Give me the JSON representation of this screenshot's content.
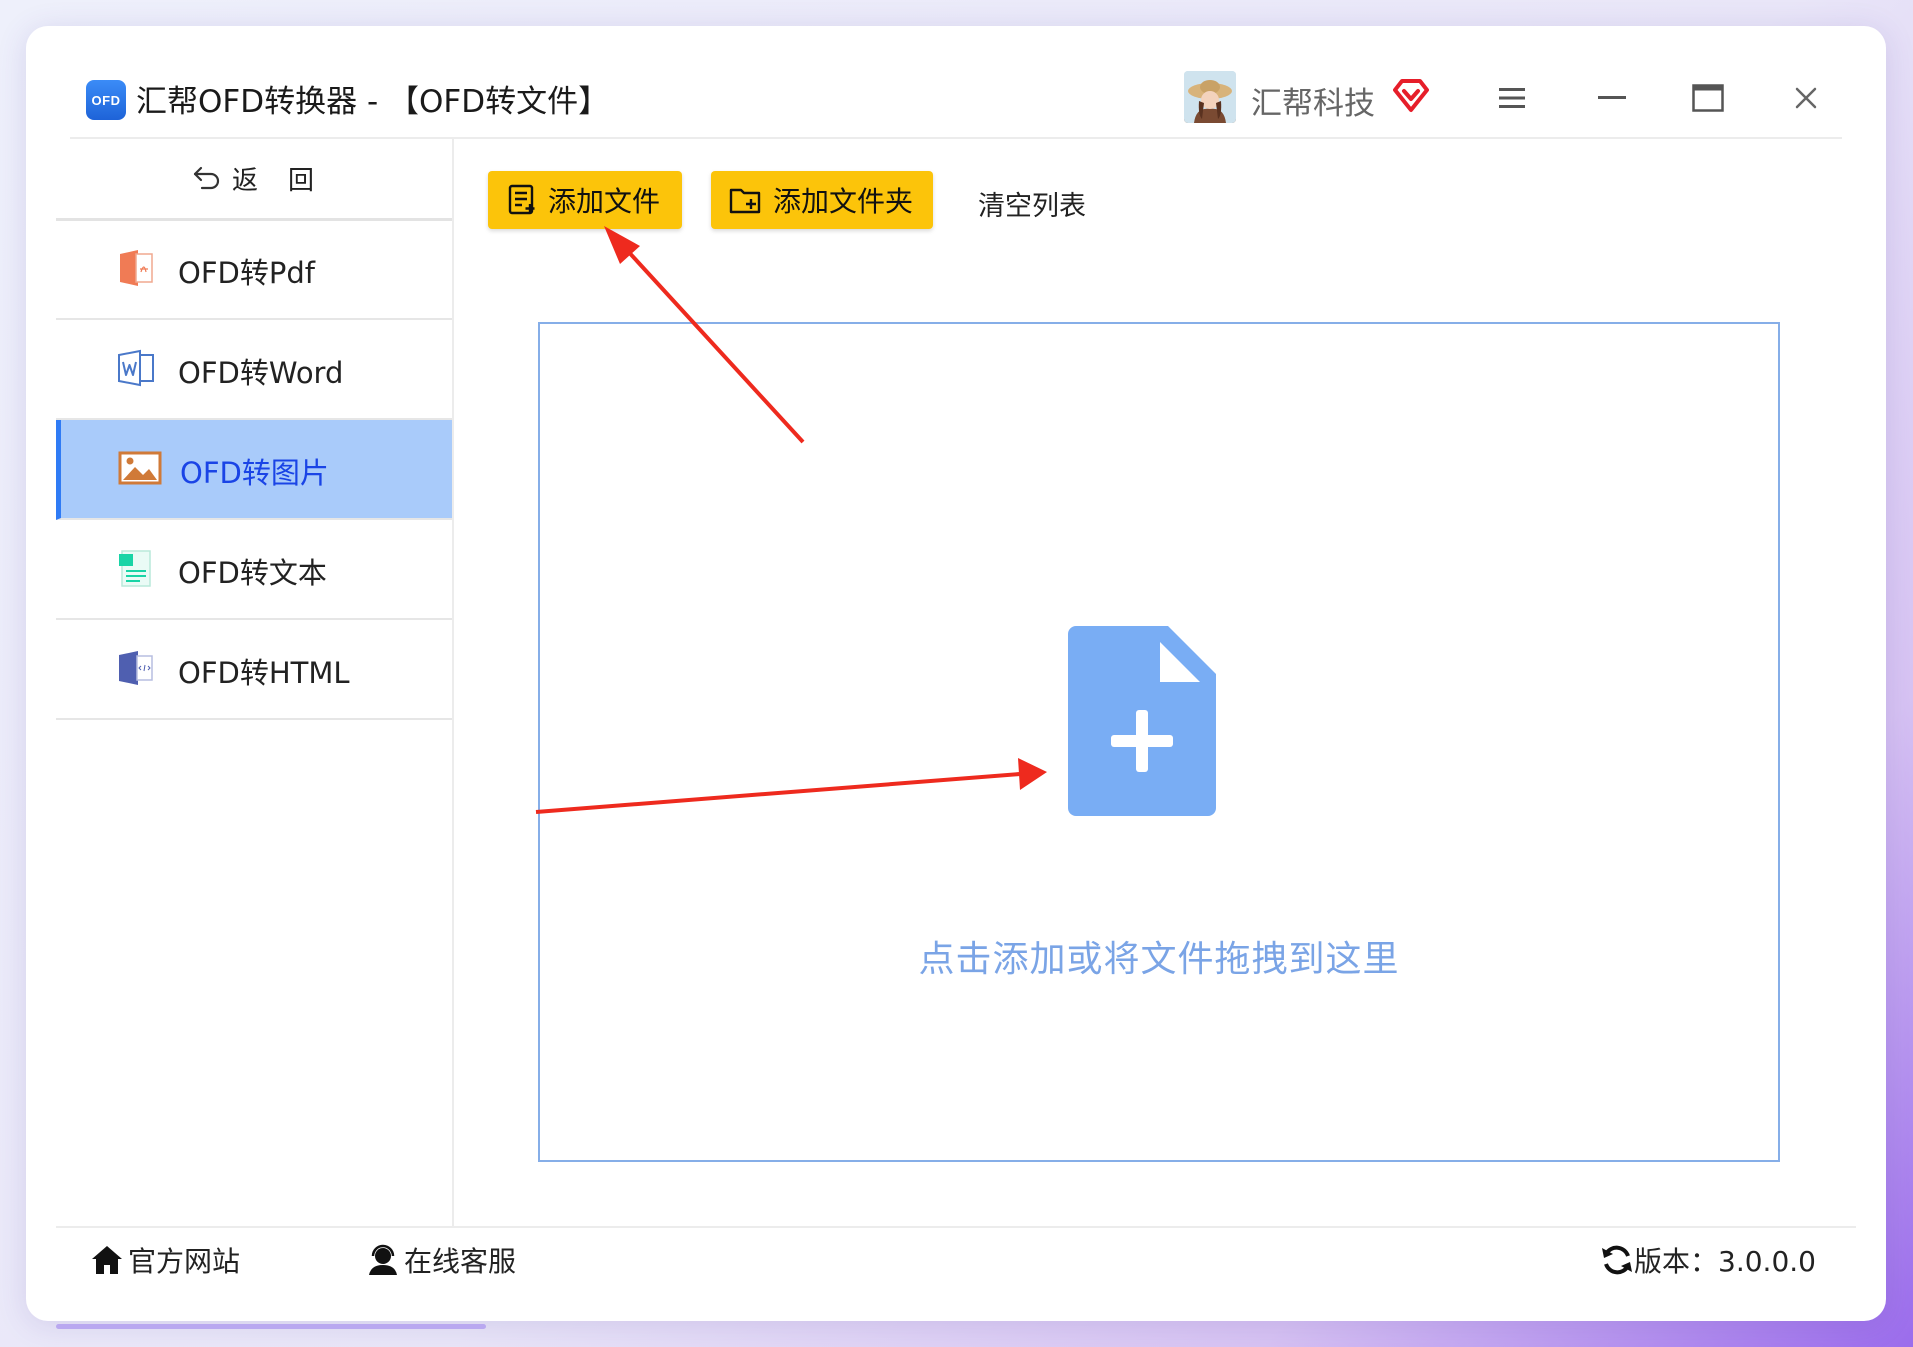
{
  "window": {
    "title": "汇帮OFD转换器 - 【OFD转文件】",
    "logo_text": "OFD",
    "brand_name": "汇帮科技",
    "accent_color": "#fcc40a",
    "active_color": "#a9cbfa"
  },
  "titlebar_icons": [
    "avatar-image",
    "vip-diamond-icon",
    "menu-icon",
    "minimize-icon",
    "maximize-icon",
    "close-icon"
  ],
  "sidebar": {
    "back_label": "返　回",
    "items": [
      {
        "label": "OFD转Pdf",
        "icon": "pdf-file-icon"
      },
      {
        "label": "OFD转Word",
        "icon": "word-file-icon"
      },
      {
        "label": "OFD转图片",
        "icon": "image-file-icon",
        "active": true
      },
      {
        "label": "OFD转文本",
        "icon": "text-file-icon"
      },
      {
        "label": "OFD转HTML",
        "icon": "html-file-icon"
      }
    ]
  },
  "toolbar": {
    "add_file": "添加文件",
    "add_folder": "添加文件夹",
    "clear_list": "清空列表"
  },
  "dropzone": {
    "hint": "点击添加或将文件拖拽到这里"
  },
  "footer": {
    "website": "官方网站",
    "support": "在线客服",
    "version": "版本：3.0.0.0"
  }
}
